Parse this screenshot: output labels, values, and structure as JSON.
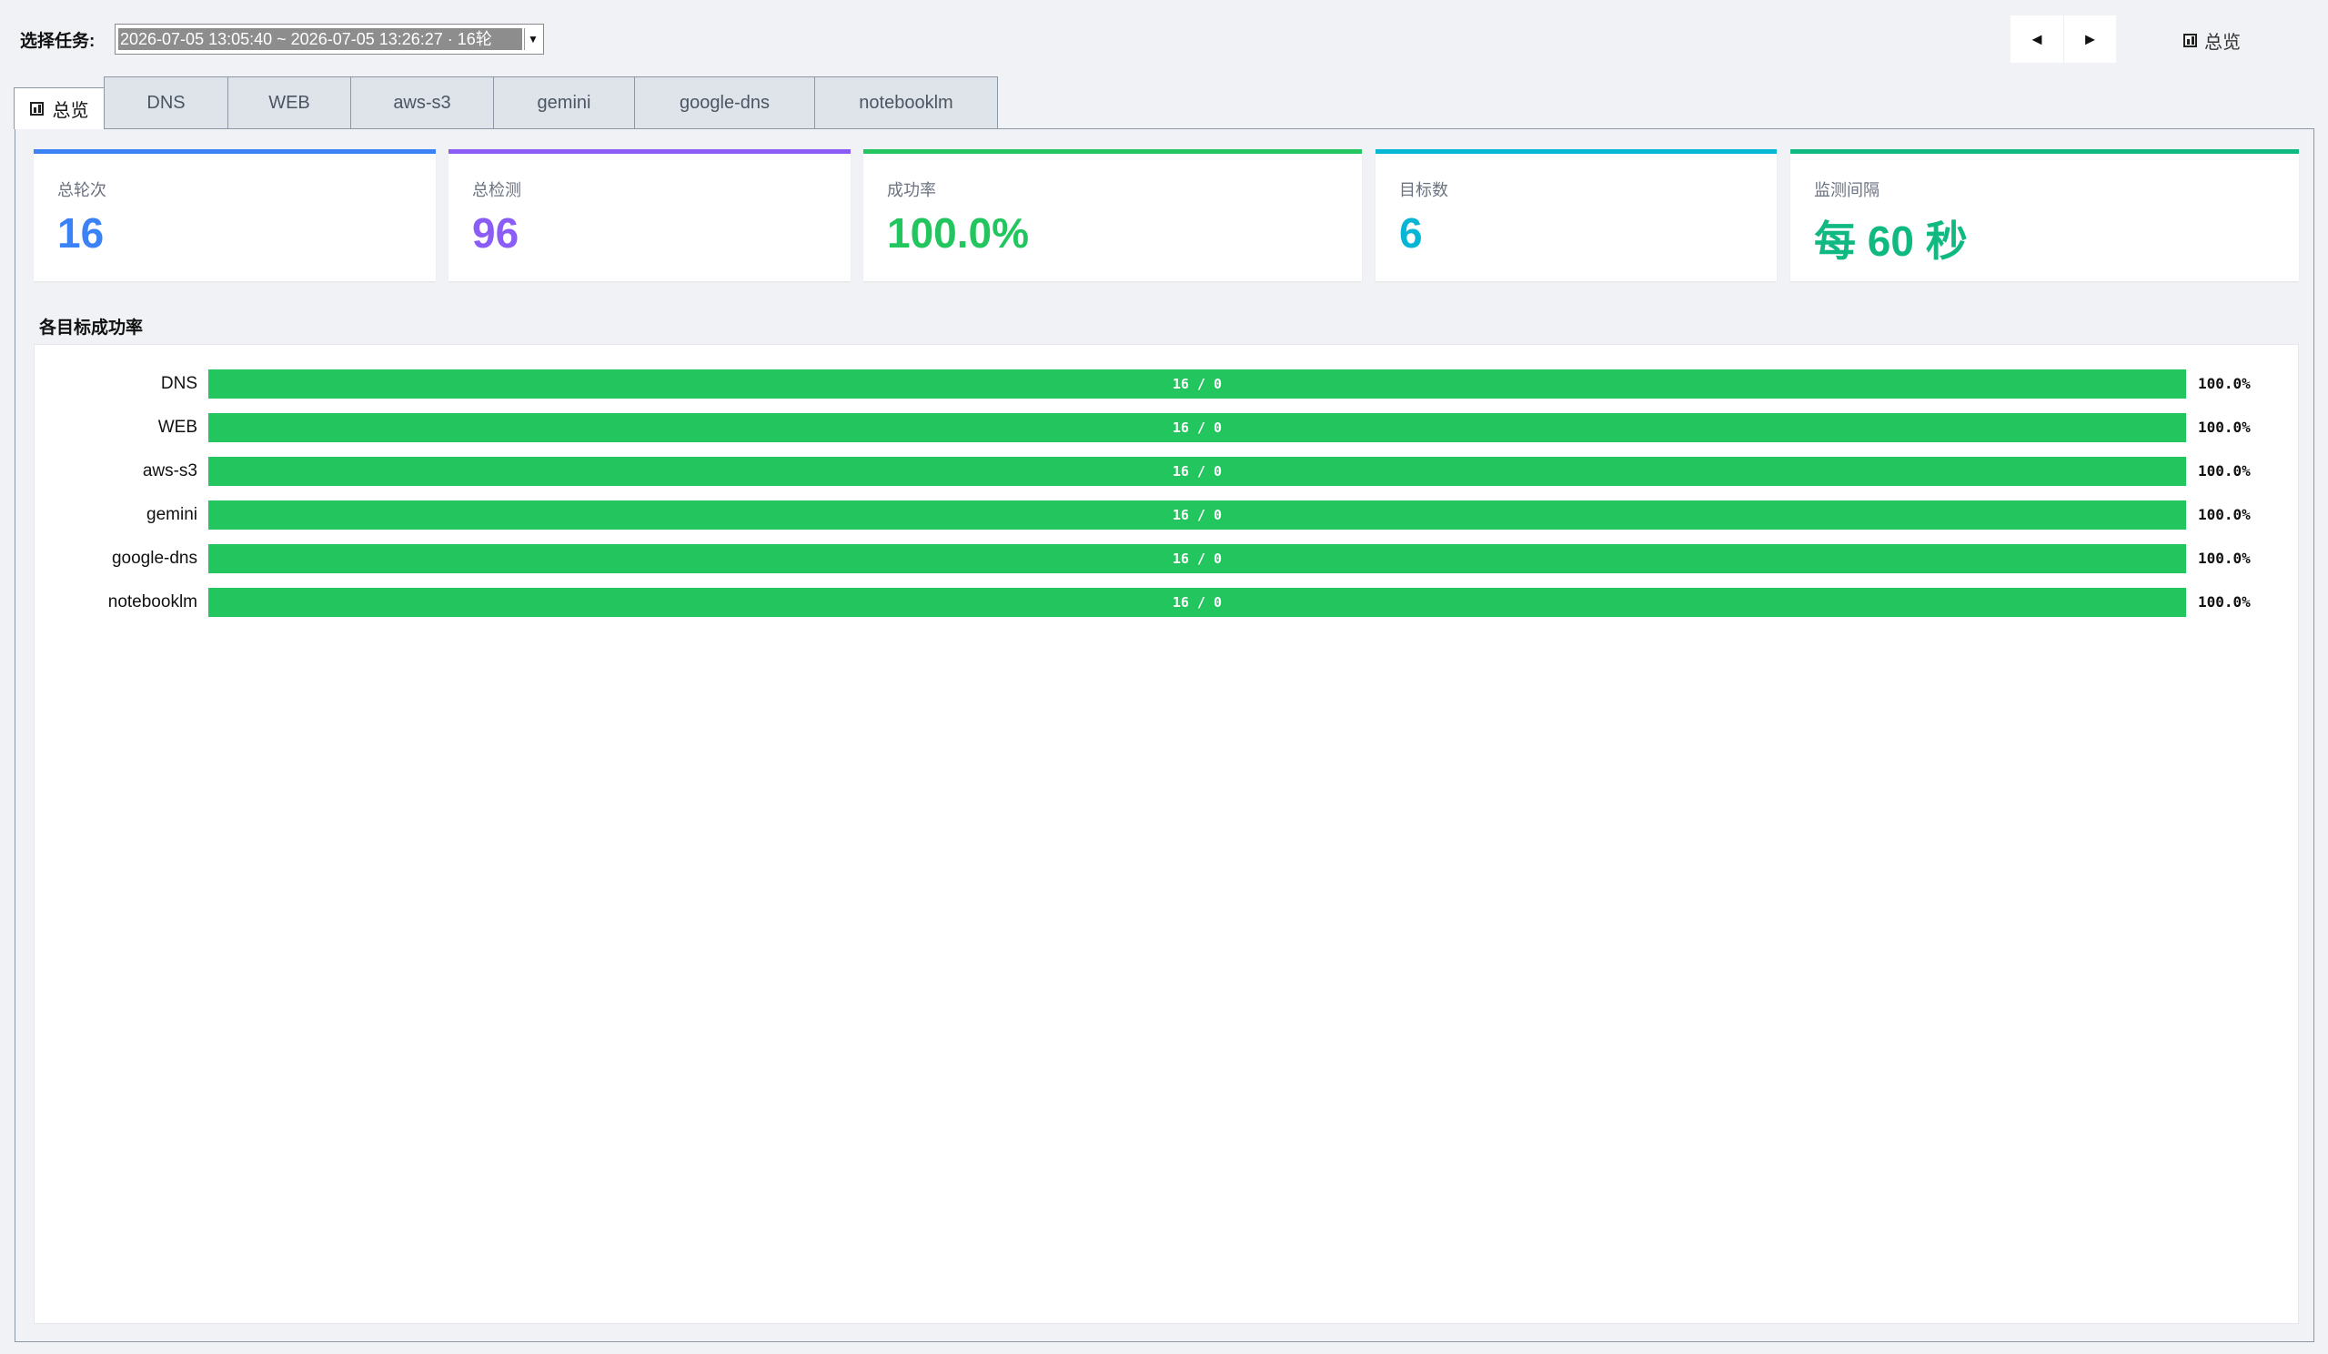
{
  "toolbar": {
    "task_label": "选择任务:",
    "task_selected": "2026-07-05 13:05:40 ~ 2026-07-05 13:26:27 · 16轮",
    "prev_symbol": "◄",
    "next_symbol": "►",
    "overview_label": "总览"
  },
  "tabs": [
    {
      "label": "总览",
      "active": true
    },
    {
      "label": "DNS"
    },
    {
      "label": "WEB"
    },
    {
      "label": "aws-s3"
    },
    {
      "label": "gemini"
    },
    {
      "label": "google-dns"
    },
    {
      "label": "notebooklm"
    }
  ],
  "stats": [
    {
      "label": "总轮次",
      "value": "16",
      "color": "#3b82f6"
    },
    {
      "label": "总检测",
      "value": "96",
      "color": "#8b5cf6"
    },
    {
      "label": "成功率",
      "value": "100.0%",
      "color": "#22c55e"
    },
    {
      "label": "目标数",
      "value": "6",
      "color": "#06b6d4"
    },
    {
      "label": "监测间隔",
      "value": "每 60 秒",
      "color": "#10b981"
    }
  ],
  "section_title": "各目标成功率",
  "bar_color": "#22c55e",
  "targets": [
    {
      "name": "DNS",
      "success_fraction": 1.0,
      "count_text": "16 / 0",
      "pct": "100.0%"
    },
    {
      "name": "WEB",
      "success_fraction": 1.0,
      "count_text": "16 / 0",
      "pct": "100.0%"
    },
    {
      "name": "aws-s3",
      "success_fraction": 1.0,
      "count_text": "16 / 0",
      "pct": "100.0%"
    },
    {
      "name": "gemini",
      "success_fraction": 1.0,
      "count_text": "16 / 0",
      "pct": "100.0%"
    },
    {
      "name": "google-dns",
      "success_fraction": 1.0,
      "count_text": "16 / 0",
      "pct": "100.0%"
    },
    {
      "name": "notebooklm",
      "success_fraction": 1.0,
      "count_text": "16 / 0",
      "pct": "100.0%"
    }
  ]
}
